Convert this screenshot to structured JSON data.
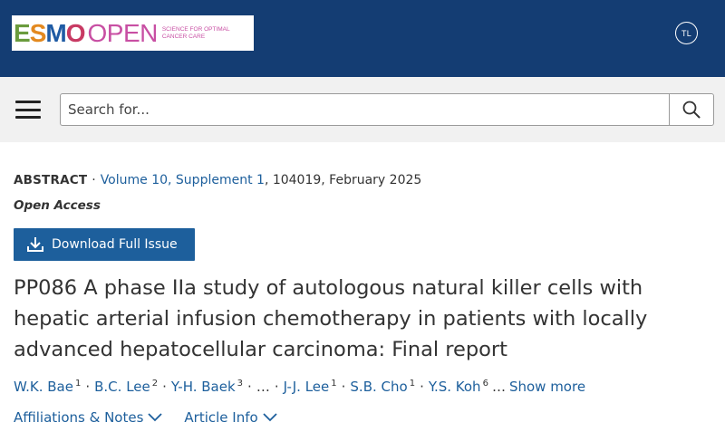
{
  "header": {
    "logo": {
      "esmo_letters": [
        "E",
        "S",
        "M",
        "O"
      ],
      "esmo_colors": [
        "#6a9b3d",
        "#e3891f",
        "#1f5ba4",
        "#c83a63"
      ],
      "open_text": "OPEN",
      "tagline": "SCIENCE FOR OPTIMAL CANCER CARE",
      "brand_color": "#c84fa3"
    },
    "user_badge": "TL",
    "bg_color": "#143d73"
  },
  "search": {
    "placeholder": "Search for...",
    "value": "",
    "menu_icon": "hamburger-menu-icon",
    "search_icon": "search-icon"
  },
  "article": {
    "type": "ABSTRACT",
    "issue_link": "Volume 10, Supplement 1",
    "issue_rest": ", 104019, February 2025",
    "access": "Open Access",
    "download_label": "Download Full Issue",
    "download_icon": "download-icon",
    "title": "PP086 A phase IIa study of autologous natural killer cells with hepatic arterial infusion chemotherapy in patients with locally advanced hepatocellular carcinoma: Final report",
    "authors": [
      {
        "name": "W.K. Bae",
        "sup": "1"
      },
      {
        "name": "B.C. Lee",
        "sup": "2"
      },
      {
        "name": "Y-H. Baek",
        "sup": "3"
      },
      {
        "name": "J-J. Lee",
        "sup": "1"
      },
      {
        "name": "S.B. Cho",
        "sup": "1"
      },
      {
        "name": "Y.S. Koh",
        "sup": "6"
      }
    ],
    "ellipsis": "…",
    "show_more": "Show more",
    "affiliations_label": "Affiliations & Notes",
    "article_info_label": "Article Info"
  },
  "colors": {
    "link": "#1d5f9c",
    "text": "#333333",
    "search_row_bg": "#f1f1f1"
  }
}
